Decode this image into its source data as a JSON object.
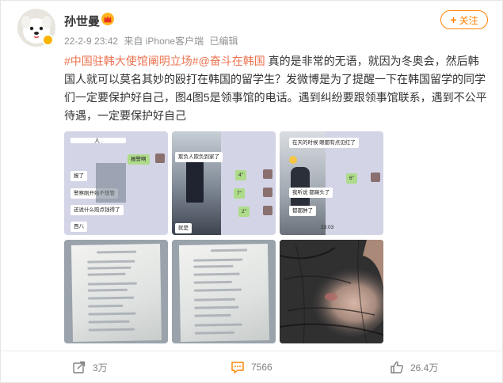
{
  "author": {
    "name": "孙世曼",
    "avatar": "avatar",
    "verified_badge": "verified-badge-icon",
    "vip_icon": "vip-crown-icon"
  },
  "meta": {
    "time": "22-2-9 23:42",
    "source": "来自 iPhone客户端",
    "edited": "已编辑"
  },
  "follow": {
    "icon": "plus-icon",
    "label": "关注"
  },
  "post": {
    "tag1": "#中国驻韩大使馆阐明立场#",
    "tag2": "@奋斗在韩国",
    "text": " 真的是非常的无语，就因为冬奥会，然后韩国人就可以莫名其妙的殴打在韩国的留学生？发微博是为了提醒一下在韩国留学的同学们一定要保护好自己，图4图5是领事馆的电话。遇到纠纷要跟领事馆联系，遇到不公平待遇，一定要保护好自己"
  },
  "images": {
    "img1": {
      "header": "人 .",
      "msgs": [
        "报警啊",
        "报了",
        "警察刚开始不想管",
        "还说什么赔点钱得了",
        "西八"
      ]
    },
    "img2": {
      "msgs": [
        "欺负人欺负到家了",
        "4\"",
        "7\"",
        "2\"",
        "就是"
      ]
    },
    "img3": {
      "msgs": [
        "在天的时候 眼都有点见红了",
        "6\"",
        "我听说 都踢头了",
        "都都肿了",
        "23:03"
      ]
    }
  },
  "actions": {
    "repost": {
      "icon": "repost-icon",
      "count": "3万"
    },
    "comment": {
      "icon": "comment-icon",
      "count": "7566"
    },
    "like": {
      "icon": "thumbs-up-icon",
      "count": "26.4万"
    }
  },
  "colors": {
    "accent": "#ff8200",
    "tag": "#eb7350",
    "meta_text": "#939393",
    "chat_bg": "#d3d4e6",
    "bubble_green": "#aedb8a",
    "comment_icon": "#ff8200"
  }
}
